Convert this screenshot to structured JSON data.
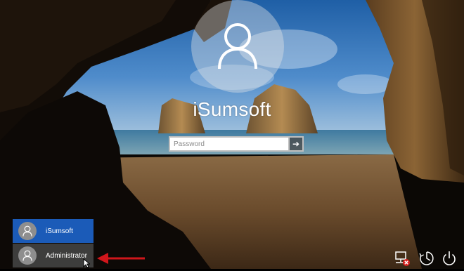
{
  "lock_screen": {
    "username": "iSumsoft",
    "password_placeholder": "Password",
    "submit_icon": "arrow-right-icon"
  },
  "user_list": [
    {
      "name": "iSumsoft",
      "selected": true
    },
    {
      "name": "Administrator",
      "selected": false
    }
  ],
  "system_icons": [
    "network-icon",
    "ease-of-access-icon",
    "power-icon"
  ],
  "colors": {
    "selected_user": "#1b5bb8",
    "annotation_arrow": "#d0161b"
  }
}
